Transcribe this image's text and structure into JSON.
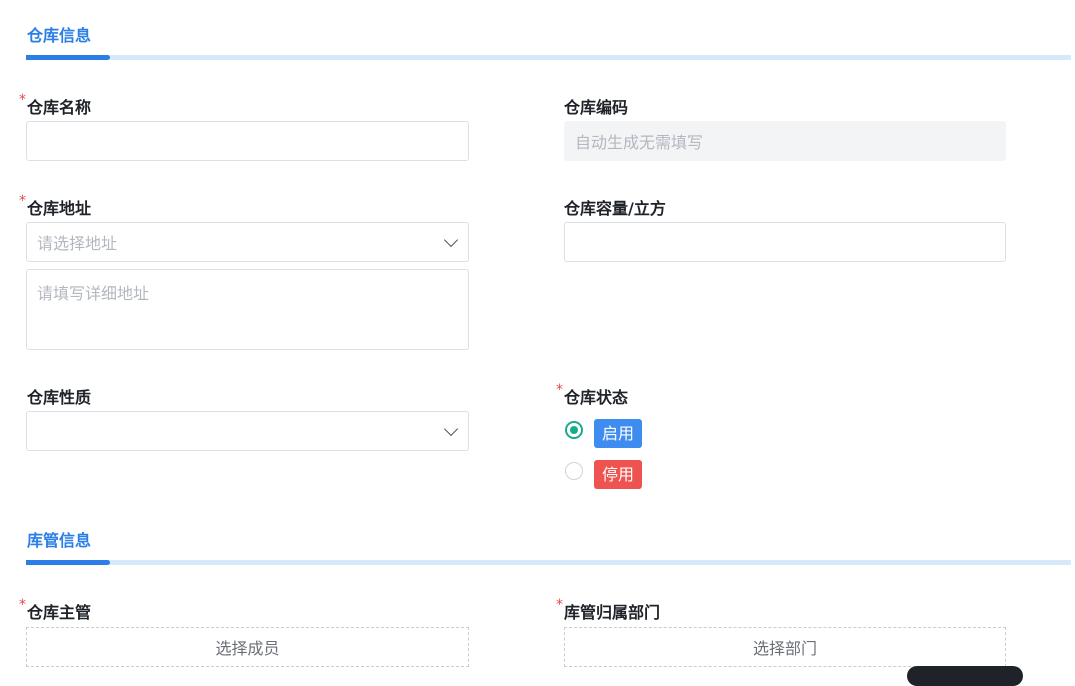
{
  "sections": {
    "warehouse_info": "仓库信息",
    "keeper_info": "库管信息"
  },
  "required_mark": "*",
  "fields": {
    "name": {
      "label": "仓库名称",
      "value": ""
    },
    "code": {
      "label": "仓库编码",
      "placeholder": "自动生成无需填写"
    },
    "address": {
      "label": "仓库地址",
      "select_placeholder": "请选择地址",
      "detail_placeholder": "请填写详细地址"
    },
    "capacity": {
      "label": "仓库容量/立方",
      "value": ""
    },
    "nature": {
      "label": "仓库性质",
      "value": ""
    },
    "status": {
      "label": "仓库状态",
      "options": [
        {
          "label": "启用",
          "selected": true,
          "color": "#3f8cf0"
        },
        {
          "label": "停用",
          "selected": false,
          "color": "#ef5350"
        }
      ]
    },
    "manager": {
      "label": "仓库主管",
      "button": "选择成员"
    },
    "department": {
      "label": "库管归属部门",
      "button": "选择部门"
    }
  },
  "colors": {
    "accent": "#2a7ee6",
    "radio_selected": "#1aab8a"
  }
}
